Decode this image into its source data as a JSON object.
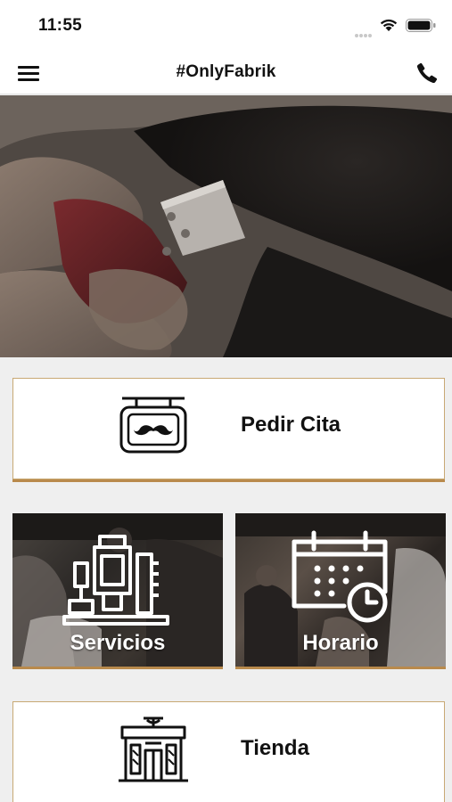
{
  "status_bar": {
    "time": "11:55"
  },
  "nav": {
    "title": "#OnlyFabrik"
  },
  "cards": {
    "pedir_cita": {
      "label": "Pedir Cita"
    },
    "servicios": {
      "label": "Servicios"
    },
    "horario": {
      "label": "Horario"
    },
    "tienda": {
      "label": "Tienda"
    }
  },
  "icons": {
    "menu": "hamburger-menu-icon",
    "phone": "phone-icon",
    "cita": "mustache-sign-icon",
    "servicios": "barber-tools-icon",
    "horario": "calendar-clock-icon",
    "tienda": "barber-shop-icon"
  },
  "colors": {
    "accent": "#b98a4c",
    "border": "#c8a974",
    "background": "#efefef"
  }
}
